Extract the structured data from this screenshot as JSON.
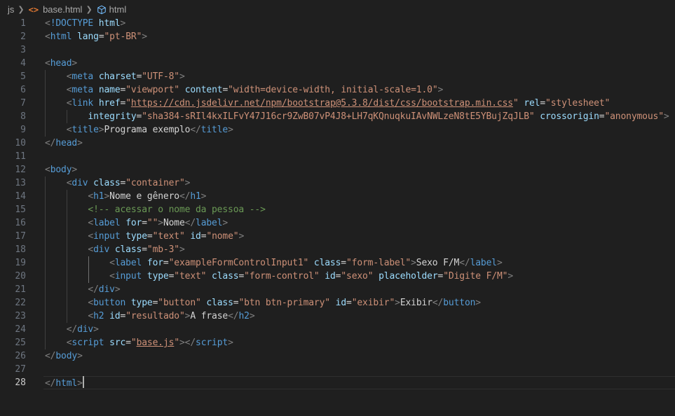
{
  "breadcrumb": {
    "folder": "js",
    "file": "base.html",
    "symbol": "html"
  },
  "colors": {
    "background": "#1f1f1f",
    "tag": "#569cd6",
    "attribute": "#9cdcfe",
    "string": "#ce9178",
    "comment": "#6a9955",
    "text": "#d4d4d4",
    "punctuation": "#808080"
  },
  "icons": [
    "chevron-right-icon",
    "html-file-icon",
    "symbol-cube-icon"
  ],
  "cursor_line": 28,
  "lines": [
    [
      [
        "p",
        "<"
      ],
      [
        "t",
        "!DOCTYPE"
      ],
      [
        "x",
        " "
      ],
      [
        "a",
        "html"
      ],
      [
        "p",
        ">"
      ]
    ],
    [
      [
        "p",
        "<"
      ],
      [
        "t",
        "html"
      ],
      [
        "x",
        " "
      ],
      [
        "a",
        "lang"
      ],
      [
        "x",
        "="
      ],
      [
        "s",
        "\"pt-BR\""
      ],
      [
        "p",
        ">"
      ]
    ],
    [],
    [
      [
        "p",
        "<"
      ],
      [
        "t",
        "head"
      ],
      [
        "p",
        ">"
      ]
    ],
    [
      [
        "x",
        "    "
      ],
      [
        "p",
        "<"
      ],
      [
        "t",
        "meta"
      ],
      [
        "x",
        " "
      ],
      [
        "a",
        "charset"
      ],
      [
        "x",
        "="
      ],
      [
        "s",
        "\"UTF-8\""
      ],
      [
        "p",
        ">"
      ]
    ],
    [
      [
        "x",
        "    "
      ],
      [
        "p",
        "<"
      ],
      [
        "t",
        "meta"
      ],
      [
        "x",
        " "
      ],
      [
        "a",
        "name"
      ],
      [
        "x",
        "="
      ],
      [
        "s",
        "\"viewport\""
      ],
      [
        "x",
        " "
      ],
      [
        "a",
        "content"
      ],
      [
        "x",
        "="
      ],
      [
        "s",
        "\"width=device-width, initial-scale=1.0\""
      ],
      [
        "p",
        ">"
      ]
    ],
    [
      [
        "x",
        "    "
      ],
      [
        "p",
        "<"
      ],
      [
        "t",
        "link"
      ],
      [
        "x",
        " "
      ],
      [
        "a",
        "href"
      ],
      [
        "x",
        "="
      ],
      [
        "s",
        "\""
      ],
      [
        "su",
        "https://cdn.jsdelivr.net/npm/bootstrap@5.3.8/dist/css/bootstrap.min.css"
      ],
      [
        "s",
        "\""
      ],
      [
        "x",
        " "
      ],
      [
        "a",
        "rel"
      ],
      [
        "x",
        "="
      ],
      [
        "s",
        "\"stylesheet\""
      ]
    ],
    [
      [
        "x",
        "        "
      ],
      [
        "a",
        "integrity"
      ],
      [
        "x",
        "="
      ],
      [
        "s",
        "\"sha384-sRIl4kxILFvY47J16cr9ZwB07vP4J8+LH7qKQnuqkuIAvNWLzeN8tE5YBujZqJLB\""
      ],
      [
        "x",
        " "
      ],
      [
        "a",
        "crossorigin"
      ],
      [
        "x",
        "="
      ],
      [
        "s",
        "\"anonymous\""
      ],
      [
        "p",
        ">"
      ]
    ],
    [
      [
        "x",
        "    "
      ],
      [
        "p",
        "<"
      ],
      [
        "t",
        "title"
      ],
      [
        "p",
        ">"
      ],
      [
        "x",
        "Programa exemplo"
      ],
      [
        "p",
        "</"
      ],
      [
        "t",
        "title"
      ],
      [
        "p",
        ">"
      ]
    ],
    [
      [
        "p",
        "</"
      ],
      [
        "t",
        "head"
      ],
      [
        "p",
        ">"
      ]
    ],
    [],
    [
      [
        "p",
        "<"
      ],
      [
        "t",
        "body"
      ],
      [
        "p",
        ">"
      ]
    ],
    [
      [
        "x",
        "    "
      ],
      [
        "p",
        "<"
      ],
      [
        "t",
        "div"
      ],
      [
        "x",
        " "
      ],
      [
        "a",
        "class"
      ],
      [
        "x",
        "="
      ],
      [
        "s",
        "\"container\""
      ],
      [
        "p",
        ">"
      ]
    ],
    [
      [
        "x",
        "        "
      ],
      [
        "p",
        "<"
      ],
      [
        "t",
        "h1"
      ],
      [
        "p",
        ">"
      ],
      [
        "x",
        "Nome e gênero"
      ],
      [
        "p",
        "</"
      ],
      [
        "t",
        "h1"
      ],
      [
        "p",
        ">"
      ]
    ],
    [
      [
        "x",
        "        "
      ],
      [
        "c",
        "<!-- acessar o nome da pessoa -->"
      ]
    ],
    [
      [
        "x",
        "        "
      ],
      [
        "p",
        "<"
      ],
      [
        "t",
        "label"
      ],
      [
        "x",
        " "
      ],
      [
        "a",
        "for"
      ],
      [
        "x",
        "="
      ],
      [
        "s",
        "\"\""
      ],
      [
        "p",
        ">"
      ],
      [
        "x",
        "Nome"
      ],
      [
        "p",
        "</"
      ],
      [
        "t",
        "label"
      ],
      [
        "p",
        ">"
      ]
    ],
    [
      [
        "x",
        "        "
      ],
      [
        "p",
        "<"
      ],
      [
        "t",
        "input"
      ],
      [
        "x",
        " "
      ],
      [
        "a",
        "type"
      ],
      [
        "x",
        "="
      ],
      [
        "s",
        "\"text\""
      ],
      [
        "x",
        " "
      ],
      [
        "a",
        "id"
      ],
      [
        "x",
        "="
      ],
      [
        "s",
        "\"nome\""
      ],
      [
        "p",
        ">"
      ]
    ],
    [
      [
        "x",
        "        "
      ],
      [
        "p",
        "<"
      ],
      [
        "t",
        "div"
      ],
      [
        "x",
        " "
      ],
      [
        "a",
        "class"
      ],
      [
        "x",
        "="
      ],
      [
        "s",
        "\"mb-3\""
      ],
      [
        "p",
        ">"
      ]
    ],
    [
      [
        "x",
        "            "
      ],
      [
        "p",
        "<"
      ],
      [
        "t",
        "label"
      ],
      [
        "x",
        " "
      ],
      [
        "a",
        "for"
      ],
      [
        "x",
        "="
      ],
      [
        "s",
        "\"exampleFormControlInput1\""
      ],
      [
        "x",
        " "
      ],
      [
        "a",
        "class"
      ],
      [
        "x",
        "="
      ],
      [
        "s",
        "\"form-label\""
      ],
      [
        "p",
        ">"
      ],
      [
        "x",
        "Sexo F/M"
      ],
      [
        "p",
        "</"
      ],
      [
        "t",
        "label"
      ],
      [
        "p",
        ">"
      ]
    ],
    [
      [
        "x",
        "            "
      ],
      [
        "p",
        "<"
      ],
      [
        "t",
        "input"
      ],
      [
        "x",
        " "
      ],
      [
        "a",
        "type"
      ],
      [
        "x",
        "="
      ],
      [
        "s",
        "\"text\""
      ],
      [
        "x",
        " "
      ],
      [
        "a",
        "class"
      ],
      [
        "x",
        "="
      ],
      [
        "s",
        "\"form-control\""
      ],
      [
        "x",
        " "
      ],
      [
        "a",
        "id"
      ],
      [
        "x",
        "="
      ],
      [
        "s",
        "\"sexo\""
      ],
      [
        "x",
        " "
      ],
      [
        "a",
        "placeholder"
      ],
      [
        "x",
        "="
      ],
      [
        "s",
        "\"Digite F/M\""
      ],
      [
        "p",
        ">"
      ]
    ],
    [
      [
        "x",
        "        "
      ],
      [
        "p",
        "</"
      ],
      [
        "t",
        "div"
      ],
      [
        "p",
        ">"
      ]
    ],
    [
      [
        "x",
        "        "
      ],
      [
        "p",
        "<"
      ],
      [
        "t",
        "button"
      ],
      [
        "x",
        " "
      ],
      [
        "a",
        "type"
      ],
      [
        "x",
        "="
      ],
      [
        "s",
        "\"button\""
      ],
      [
        "x",
        " "
      ],
      [
        "a",
        "class"
      ],
      [
        "x",
        "="
      ],
      [
        "s",
        "\"btn btn-primary\""
      ],
      [
        "x",
        " "
      ],
      [
        "a",
        "id"
      ],
      [
        "x",
        "="
      ],
      [
        "s",
        "\"exibir\""
      ],
      [
        "p",
        ">"
      ],
      [
        "x",
        "Exibir"
      ],
      [
        "p",
        "</"
      ],
      [
        "t",
        "button"
      ],
      [
        "p",
        ">"
      ]
    ],
    [
      [
        "x",
        "        "
      ],
      [
        "p",
        "<"
      ],
      [
        "t",
        "h2"
      ],
      [
        "x",
        " "
      ],
      [
        "a",
        "id"
      ],
      [
        "x",
        "="
      ],
      [
        "s",
        "\"resultado\""
      ],
      [
        "p",
        ">"
      ],
      [
        "x",
        "A frase"
      ],
      [
        "p",
        "</"
      ],
      [
        "t",
        "h2"
      ],
      [
        "p",
        ">"
      ]
    ],
    [
      [
        "x",
        "    "
      ],
      [
        "p",
        "</"
      ],
      [
        "t",
        "div"
      ],
      [
        "p",
        ">"
      ]
    ],
    [
      [
        "x",
        "    "
      ],
      [
        "p",
        "<"
      ],
      [
        "t",
        "script"
      ],
      [
        "x",
        " "
      ],
      [
        "a",
        "src"
      ],
      [
        "x",
        "="
      ],
      [
        "s",
        "\""
      ],
      [
        "su",
        "base.js"
      ],
      [
        "s",
        "\""
      ],
      [
        "p",
        "></"
      ],
      [
        "t",
        "script"
      ],
      [
        "p",
        ">"
      ]
    ],
    [
      [
        "p",
        "</"
      ],
      [
        "t",
        "body"
      ],
      [
        "p",
        ">"
      ]
    ],
    [],
    [
      [
        "p",
        "</"
      ],
      [
        "t",
        "html"
      ],
      [
        "p",
        ">"
      ]
    ]
  ]
}
